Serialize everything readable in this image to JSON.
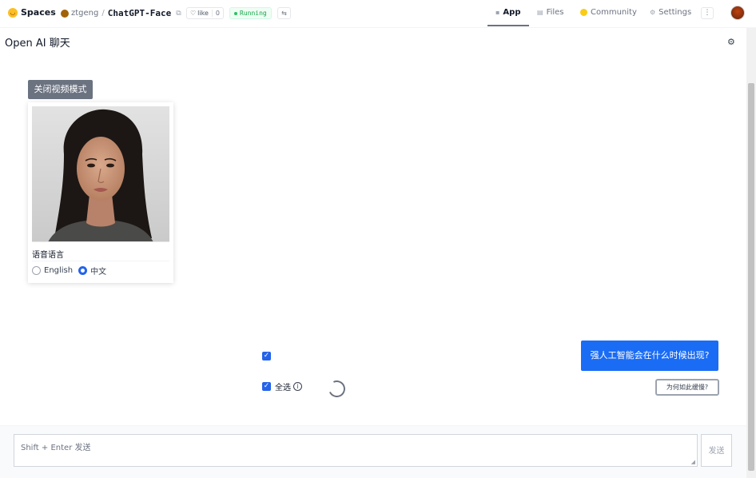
{
  "header": {
    "logo_label": "Spaces",
    "owner": "ztgeng",
    "repo": "ChatGPT-Face",
    "like_label": "like",
    "like_count": "0",
    "status": "Running",
    "tabs": [
      {
        "label": "App",
        "icon": "app-icon"
      },
      {
        "label": "Files",
        "icon": "files-icon"
      },
      {
        "label": "Community",
        "icon": "community-icon"
      },
      {
        "label": "Settings",
        "icon": "settings-icon"
      }
    ]
  },
  "app": {
    "title": "Open AI 聊天",
    "video_mode_button": "关闭视频模式",
    "language_label": "语音语言",
    "languages": [
      {
        "label": "English",
        "selected": false
      },
      {
        "label": "中文",
        "selected": true
      }
    ],
    "select_all_label": "全选",
    "chat_message": "强人工智能会在什么时候出现?",
    "why_button": "为何如此缓慢?",
    "input_placeholder": "Shift + Enter 发送",
    "send_button": "发送"
  },
  "colors": {
    "accent": "#1a6cf5",
    "checkbox": "#2563eb",
    "running": "#16a34a",
    "video_button_bg": "#6b7280"
  }
}
